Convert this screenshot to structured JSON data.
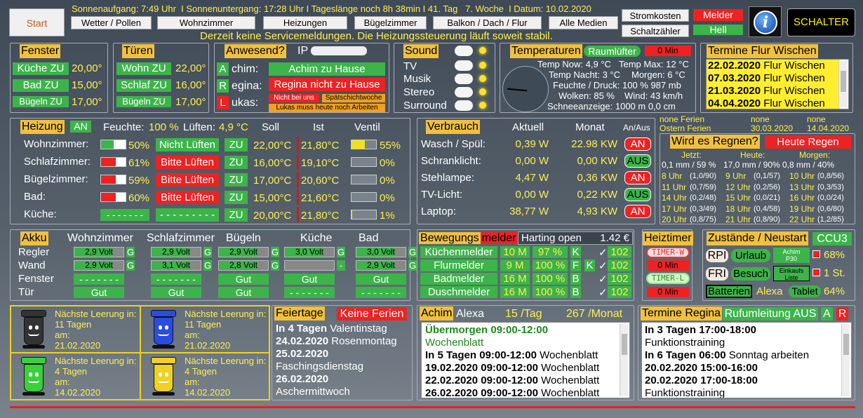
{
  "top": {
    "start": "Start",
    "sunrise": "Sonnenaufgang: 7:49 Uhr",
    "sunset": "Sonnenuntergang: 17:28 Uhr",
    "daylength": "Tageslänge noch 8h 38min",
    "day": "41. Tag",
    "week": "7. Woche",
    "date": "Datum: 10.02.2020",
    "nav": [
      "Wetter / Pollen",
      "Wohnzimmer",
      "Heizungen",
      "Bügelzimmer",
      "Balkon / Dach / Flur",
      "Alle Medien"
    ],
    "service": "Derzeit keine Servicemeldungen. Die Heizungssteuerung läuft soweit stabil.",
    "stromkosten": "Stromkosten",
    "schaltzaehler": "Schaltzähler",
    "melder": "Melder",
    "hell": "Hell",
    "schalter": "SCHALTER",
    "info": "i"
  },
  "fenster": {
    "title": "Fenster",
    "rows": [
      [
        "Küche ZU",
        "20,00°"
      ],
      [
        "Bad ZU",
        "15,00°"
      ],
      [
        "Bügeln ZU",
        "17,00°"
      ]
    ]
  },
  "tueren": {
    "title": "Türen",
    "rows": [
      [
        "Wohn ZU",
        "22,00°"
      ],
      [
        "Schlaf ZU",
        "16,00°"
      ],
      [
        "Bügeln ZU",
        "17,00°"
      ]
    ]
  },
  "anwesend": {
    "title": "Anwesend?",
    "ip": "IP",
    "rows": [
      {
        "letter": "A",
        "name": "chim:",
        "status": "Achim zu Hause"
      },
      {
        "letter": "R",
        "name": "egina:",
        "status": "Regina nicht zu Hause"
      },
      {
        "letter": "L",
        "name": "ukas:"
      }
    ],
    "tag1": "Nicht bei uns",
    "tag2": "Spätschichtwoche",
    "tag3": "Lukas muss heute noch Arbeiten"
  },
  "sound": {
    "title": "Sound",
    "items": [
      "TV",
      "Musik",
      "Stereo",
      "Surround"
    ]
  },
  "temperatur": {
    "title": "Temperaturen",
    "luefter": "Raumlüfter",
    "luefter_val": "0 Min",
    "now": "Temp Now:  4,9 °C",
    "max": "Temp Max:  12 °C",
    "nacht": "Temp Nacht:  3 °C",
    "morgen": "Morgen:  6 °C",
    "feuchte": "Feuchte / Druck:  100 %  987 mb",
    "wolken": "Wolken:  85 %",
    "wind": "Wind:  43 km/h",
    "schnee": "Schneeanzeige:  1000 m   0,0 cm"
  },
  "termine_flur": {
    "title": "Termine Flur Wischen",
    "items": [
      [
        "22.02.2020",
        "Flur Wischen"
      ],
      [
        "07.03.2020",
        "Flur Wischen"
      ],
      [
        "21.03.2020",
        "Flur Wischen"
      ],
      [
        "04.04.2020",
        "Flur Wischen"
      ]
    ]
  },
  "heizung": {
    "title": "Heizung",
    "an": "AN",
    "feuchte": "Feuchte:",
    "feuchte_v": "100 %",
    "lueften": "Lüften:",
    "lueften_v": "4,9 °C",
    "soll": "Soll",
    "ist": "Ist",
    "ventil": "Ventil",
    "rows": [
      {
        "name": "Wohnzimmer:",
        "hum": "50%",
        "humf": 0.5,
        "hc": "#3cb44a",
        "msg": "Nicht Lüften",
        "mc": "#3cb44a",
        "zu": "ZU",
        "soll": "22,00°C",
        "ist": "21,80°C",
        "ven": "55%",
        "venf": 0.55
      },
      {
        "name": "Schlafzimmer:",
        "hum": "61%",
        "humf": 0.61,
        "hc": "#ee2222",
        "msg": "Bitte Lüften",
        "mc": "#ee2222",
        "zu": "ZU",
        "soll": "16,00°C",
        "ist": "19,10°C",
        "ven": "0%",
        "venf": 0
      },
      {
        "name": "Bügelzimmer:",
        "hum": "59%",
        "humf": 0.59,
        "hc": "#ee2222",
        "msg": "Bitte Lüften",
        "mc": "#ee2222",
        "zu": "ZU",
        "soll": "17,00°C",
        "ist": "20,60°C",
        "ven": "0%",
        "venf": 0
      },
      {
        "name": "Bad:",
        "hum": "60%",
        "humf": 0.6,
        "hc": "#ee2222",
        "msg": "Bitte Lüften",
        "mc": "#ee2222",
        "zu": "ZU",
        "soll": "15,00°C",
        "ist": "21,60°C",
        "ven": "0%",
        "venf": 0
      },
      {
        "name": "Küche:",
        "hum": "- - - - - - -",
        "humf": 0,
        "hc": "#3cb44a",
        "msg": "- - - - - - - - -",
        "mc": "#3cb44a",
        "zu": "ZU",
        "soll": "20,00°C",
        "ist": "21,80°C",
        "ven": "1%",
        "venf": 0.01
      }
    ]
  },
  "verbrauch": {
    "title": "Verbrauch",
    "aktuell": "Aktuell",
    "monat": "Monat",
    "anaus": "An/Aus",
    "rows": [
      [
        "Wasch / Spül:",
        "0,39 W",
        "22.98 KW",
        "AN"
      ],
      [
        "Schranklicht:",
        "0,00 W",
        "0,00 KW",
        "AUS"
      ],
      [
        "Stehlampe:",
        "4,47 W",
        "0,36 KW",
        "AN"
      ],
      [
        "TV-Licht:",
        "0,00 W",
        "0,22 KW",
        "AUS"
      ],
      [
        "Laptop:",
        "38,77 W",
        "4,93 KW",
        "AN"
      ]
    ]
  },
  "ferien": {
    "l1": "none Ferien",
    "l1a": "none",
    "l1b": "none",
    "l2": "Ostern Ferien",
    "l2a": "30.03.2020",
    "l2b": "14.04.2020"
  },
  "regen": {
    "title": "Wird es Regnen?",
    "badge": "Heute Regen",
    "h": [
      "Jetzt:",
      "Heute:",
      "Morgen:"
    ],
    "v": [
      "0,1 mm / 59 %",
      "17,0 mm / 90%",
      "0,8 mm / 40%"
    ],
    "rows": [
      [
        "8 Uhr",
        "(1,0/90)",
        "9 Uhr",
        "(0,1/57)",
        "10 Uhr",
        "(0,8/56)"
      ],
      [
        "11 Uhr",
        "(0,7/59)",
        "12 Uhr",
        "(0,2/56)",
        "13 Uhr",
        "(0,3/53)"
      ],
      [
        "14 Uhr",
        "(0,2/48)",
        "15 Uhr",
        "(0,0/21)",
        "16 Uhr",
        "(0,0/24)"
      ],
      [
        "17 Uhr",
        "(0,3/49)",
        "18 Uhr",
        "(0,4/58)",
        "19 Uhr",
        "(0,6/80)"
      ],
      [
        "20 Uhr",
        "(0,8/75)",
        "21 Uhr",
        "(0,8/90)",
        "22 Uhr",
        "(1,2/85)"
      ]
    ]
  },
  "akku": {
    "title": "Akku",
    "cols": [
      "Wohnzimmer",
      "Schlafzimmer",
      "Bügeln",
      "Küche",
      "Bad"
    ],
    "rl": [
      "Regler",
      "Wand",
      "Fenster",
      "Tür"
    ],
    "regler": [
      "2,9 Volt",
      "2,9 Volt",
      "2,9 Volt",
      "3,0 Volt",
      "3,0 Volt"
    ],
    "wand": [
      "2,9 Volt",
      "3,1 Volt",
      "2,8 Volt",
      "",
      "2,9 Volt"
    ],
    "wandg": [
      "G",
      "G",
      "G",
      "-",
      "G"
    ],
    "fenster": [
      "- - - - - - -",
      "- - - - - - -",
      "Gut",
      "Gut",
      "Gut"
    ],
    "tuer": [
      "Gut",
      "Gut",
      "Gut",
      "- - - - - - -",
      "- - - - - - -"
    ],
    "g": "G"
  },
  "bewegung": {
    "title1": "Bewegungs",
    "title2": "melder",
    "harting": "Harting open",
    "price": "1.42 €",
    "rows": [
      [
        "Küchenmelder",
        "10 M",
        "97 %",
        "K",
        "",
        "102"
      ],
      [
        "Flurmelder",
        "9 M",
        "100 %",
        "F",
        "K",
        "102"
      ],
      [
        "Badmelder",
        "16 M",
        "100 %",
        "B",
        "",
        "102"
      ],
      [
        "Duschmelder",
        "16 M",
        "100 %",
        "B",
        "",
        "102"
      ]
    ],
    "check": "✓"
  },
  "heiztimer": {
    "title": "Heiztimer",
    "t1": "TIMER-W",
    "v1": "0 Min",
    "t2": "TIMER-L",
    "v2": "0 Min"
  },
  "zustaende": {
    "title": "Zustände / Neustart",
    "ccu": "CCU3",
    "rpi": "RPI",
    "urlaub": "Urlaub",
    "achim": "Achim",
    "p30": "P30",
    "pct1": "68%",
    "fri": "FRI",
    "besuch": "Besuch",
    "einkauf": "Einkaufs",
    "liste": "Liste",
    "st": "1 St.",
    "batterien": "Batterien",
    "alexa": "Alexa",
    "tablet": "Tablet",
    "pct2": "64%"
  },
  "muell": {
    "label": "Nächste Leerung in:",
    "am": "am:",
    "items": [
      {
        "days": "11 Tagen",
        "date": "21.02.2020",
        "color": "#333"
      },
      {
        "days": "11 Tagen",
        "date": "21.02.2020",
        "color": "#2a4de0"
      },
      {
        "days": "4 Tagen",
        "date": "14.02.2020",
        "color": "#3ad03a"
      },
      {
        "days": "4 Tagen",
        "date": "14.02.2020",
        "color": "#f0d020"
      }
    ]
  },
  "feiertage": {
    "title": "Feiertage",
    "badge": "Keine Ferien",
    "lines": [
      [
        "In 4 Tagen",
        "Valentinstag"
      ],
      [
        "24.02.2020",
        "Rosenmontag"
      ],
      [
        "25.02.2020",
        ""
      ],
      [
        "",
        "Faschingsdienstag"
      ],
      [
        "26.02.2020",
        ""
      ],
      [
        "",
        "Aschermittwoch"
      ]
    ]
  },
  "achim": {
    "title": "Achim",
    "alexa": "Alexa",
    "tag": "15 /Tag",
    "monat": "267 /Monat",
    "lines": [
      [
        "Übermorgen 09:00-12:00",
        ""
      ],
      [
        "",
        "Wochenblatt"
      ],
      [
        "In 5 Tagen 09:00-12:00",
        "Wochenblatt"
      ],
      [
        "19.02.2020 09:00-12:00",
        "Wochenblatt"
      ],
      [
        "22.02.2020 09:00-12:00",
        "Wochenblatt"
      ],
      [
        "26.02.2020 09:00-12:00",
        "Wochenblatt"
      ]
    ]
  },
  "regina": {
    "title": "Termine Regina",
    "ruf": "Rufumleitung AUS",
    "a": "A",
    "r": "R",
    "lines": [
      [
        "In 3 Tagen 17:00-18:00",
        ""
      ],
      [
        "",
        "Funktionstraining"
      ],
      [
        "In 6 Tagen 06:00",
        "Sonntag arbeiten"
      ],
      [
        "20.02.2020 15:00-16:00",
        ""
      ],
      [
        "20.02.2020 17:00-18:00",
        ""
      ],
      [
        "",
        "Funktionstraining"
      ]
    ]
  }
}
